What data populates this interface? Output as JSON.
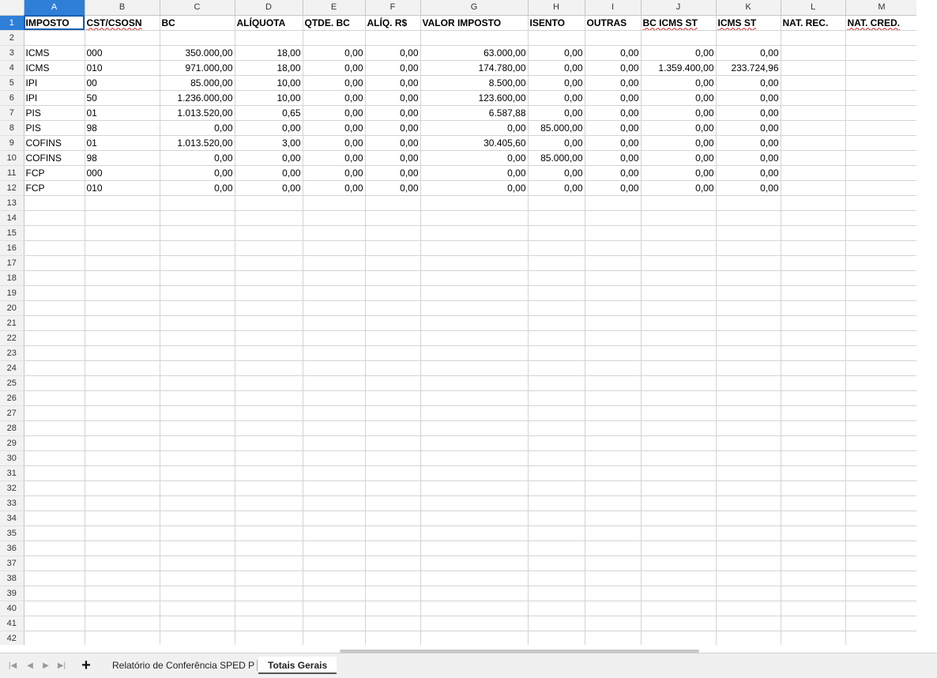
{
  "columns": [
    "A",
    "B",
    "C",
    "D",
    "E",
    "F",
    "G",
    "H",
    "I",
    "J",
    "K",
    "L",
    "M"
  ],
  "headers": [
    "IMPOSTO",
    "CST/CSOSN",
    "BC",
    "ALÍQUOTA",
    "QTDE. BC",
    "ALÍQ. R$",
    "VALOR IMPOSTO",
    "ISENTO",
    "OUTRAS",
    "BC ICMS ST",
    "ICMS ST",
    "NAT. REC.",
    "NAT. CRED."
  ],
  "rows": [
    [
      "ICMS",
      "000",
      "350.000,00",
      "18,00",
      "0,00",
      "0,00",
      "63.000,00",
      "0,00",
      "0,00",
      "0,00",
      "0,00",
      "",
      ""
    ],
    [
      "ICMS",
      "010",
      "971.000,00",
      "18,00",
      "0,00",
      "0,00",
      "174.780,00",
      "0,00",
      "0,00",
      "1.359.400,00",
      "233.724,96",
      "",
      ""
    ],
    [
      "IPI",
      "00",
      "85.000,00",
      "10,00",
      "0,00",
      "0,00",
      "8.500,00",
      "0,00",
      "0,00",
      "0,00",
      "0,00",
      "",
      ""
    ],
    [
      "IPI",
      "50",
      "1.236.000,00",
      "10,00",
      "0,00",
      "0,00",
      "123.600,00",
      "0,00",
      "0,00",
      "0,00",
      "0,00",
      "",
      ""
    ],
    [
      "PIS",
      "01",
      "1.013.520,00",
      "0,65",
      "0,00",
      "0,00",
      "6.587,88",
      "0,00",
      "0,00",
      "0,00",
      "0,00",
      "",
      ""
    ],
    [
      "PIS",
      "98",
      "0,00",
      "0,00",
      "0,00",
      "0,00",
      "0,00",
      "85.000,00",
      "0,00",
      "0,00",
      "0,00",
      "",
      ""
    ],
    [
      "COFINS",
      "01",
      "1.013.520,00",
      "3,00",
      "0,00",
      "0,00",
      "30.405,60",
      "0,00",
      "0,00",
      "0,00",
      "0,00",
      "",
      ""
    ],
    [
      "COFINS",
      "98",
      "0,00",
      "0,00",
      "0,00",
      "0,00",
      "0,00",
      "85.000,00",
      "0,00",
      "0,00",
      "0,00",
      "",
      ""
    ],
    [
      "FCP",
      "000",
      "0,00",
      "0,00",
      "0,00",
      "0,00",
      "0,00",
      "0,00",
      "0,00",
      "0,00",
      "0,00",
      "",
      ""
    ],
    [
      "FCP",
      "010",
      "0,00",
      "0,00",
      "0,00",
      "0,00",
      "0,00",
      "0,00",
      "0,00",
      "0,00",
      "0,00",
      "",
      ""
    ]
  ],
  "row_numbers": [
    "1",
    "2",
    "3",
    "4",
    "5",
    "6",
    "7",
    "8",
    "9",
    "10",
    "11",
    "12",
    "13",
    "14",
    "15",
    "16",
    "17",
    "18",
    "19",
    "20",
    "21",
    "22",
    "23",
    "24",
    "25",
    "26",
    "27",
    "28",
    "29",
    "30",
    "31",
    "32",
    "33",
    "34",
    "35",
    "36",
    "37",
    "38",
    "39",
    "40",
    "41",
    "42"
  ],
  "tabs": {
    "first_icon": "first-sheet-icon",
    "prev_icon": "prev-sheet-icon",
    "next_icon": "next-sheet-icon",
    "last_icon": "last-sheet-icon",
    "add_icon": "plus-icon",
    "sheet1": "Relatório de Conferência SPED P",
    "sheet2": "Totais Gerais"
  },
  "colors": {
    "selection": "#2f7fd8",
    "spellcheck": "#d02020"
  }
}
